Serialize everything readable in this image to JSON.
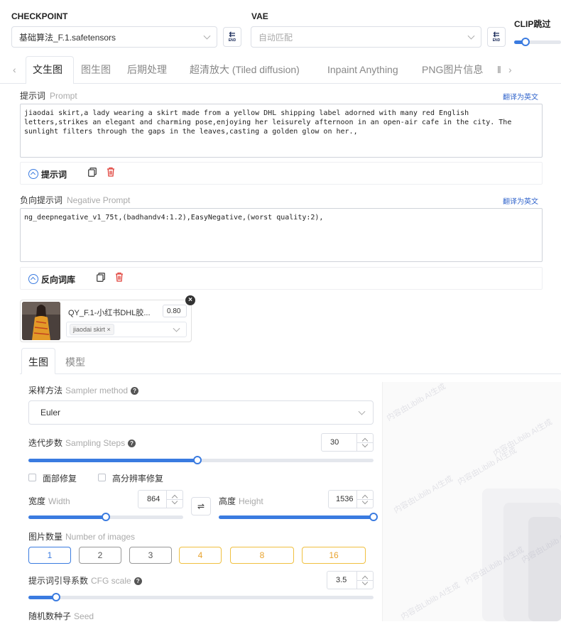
{
  "checkpoint": {
    "label": "CHECKPOINT",
    "value": "基础算法_F.1.safetensors"
  },
  "vae": {
    "label": "VAE",
    "value": "自动匹配"
  },
  "clip": {
    "label": "CLIP跳过"
  },
  "end_btn_text": "END",
  "tabs": [
    "文生图",
    "图生图",
    "后期处理",
    "超清放大 (Tiled diffusion)",
    "Inpaint Anything",
    "PNG图片信息",
    "‖"
  ],
  "prompt": {
    "label": "提示词",
    "label_en": "Prompt",
    "translate": "翻译为英文",
    "text": "jiaodai skirt,a lady wearing a skirt made from a yellow DHL shipping label adorned with many red English\nletters,strikes an elegant and charming pose,enjoying her leisurely afternoon in an open-air cafe in the city. The\nsunlight filters through the gaps in the leaves,casting a golden glow on her.,",
    "library_label": "提示词"
  },
  "negative": {
    "label": "负向提示词",
    "label_en": "Negative Prompt",
    "translate": "翻译为英文",
    "text": "ng_deepnegative_v1_75t,(badhandv4:1.2),EasyNegative,(worst quality:2),",
    "library_label": "反向词库"
  },
  "lora": {
    "name": "QY_F.1-小红书DHL胶...",
    "weight": "0.80",
    "trigger": "jiaodai skirt"
  },
  "subtabs": [
    "生图",
    "模型"
  ],
  "sampler": {
    "label": "采样方法",
    "label_en": "Sampler method",
    "value": "Euler"
  },
  "steps": {
    "label": "迭代步数",
    "label_en": "Sampling Steps",
    "value": "30",
    "fraction": 0.49
  },
  "face_restore": {
    "label": "面部修复",
    "checked": false
  },
  "hires_fix": {
    "label": "高分辨率修复",
    "checked": false
  },
  "width": {
    "label": "宽度",
    "label_en": "Width",
    "value": "864",
    "fraction": 0.5
  },
  "height": {
    "label": "高度",
    "label_en": "Height",
    "value": "1536",
    "fraction": 1.0
  },
  "swap_icon": "⇌",
  "num_images": {
    "label": "图片数量",
    "label_en": "Number of images",
    "options": [
      "1",
      "2",
      "3",
      "4",
      "8",
      "16"
    ],
    "selected": "1"
  },
  "cfg": {
    "label": "提示词引导系数",
    "label_en": "CFG scale",
    "value": "3.5",
    "fraction": 0.08
  },
  "seed": {
    "label": "随机数种子",
    "label_en": "Seed"
  },
  "watermark": "内容由Liblib AI生成",
  "colors": {
    "accent": "#3a7be0",
    "gold": "#e8a32e",
    "delete": "#e0413a"
  }
}
